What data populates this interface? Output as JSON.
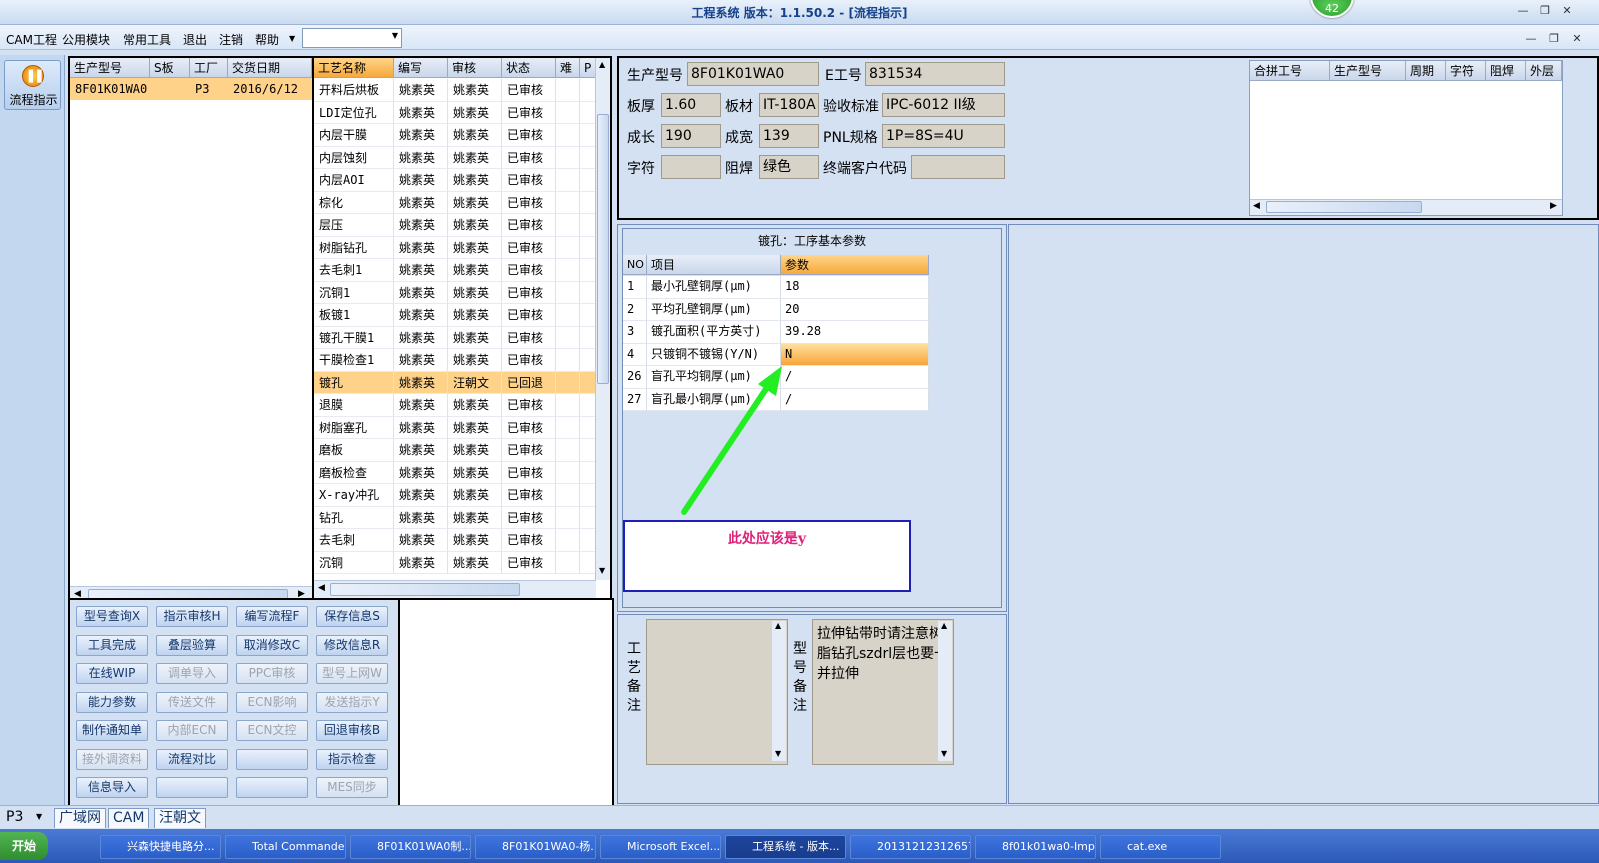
{
  "window": {
    "title": "工程系统  版本：1.1.50.2 - [流程指示]",
    "badge": "42"
  },
  "menu": [
    "CAM工程",
    "公用模块",
    "常用工具",
    "退出",
    "注销",
    "帮助"
  ],
  "left": {
    "flow_button": "流程指示"
  },
  "orders": {
    "headers": [
      "生产型号",
      "S板",
      "工厂",
      "交货日期"
    ],
    "rows": [
      [
        "8F01K01WA0",
        "",
        "P3",
        "2016/6/12"
      ]
    ]
  },
  "process": {
    "headers": [
      "工艺名称",
      "编写",
      "审核",
      "状态",
      "难",
      "P"
    ],
    "rows": [
      [
        "开料后烘板",
        "姚素英",
        "姚素英",
        "已审核"
      ],
      [
        "LDI定位孔",
        "姚素英",
        "姚素英",
        "已审核"
      ],
      [
        "内层干膜",
        "姚素英",
        "姚素英",
        "已审核"
      ],
      [
        "内层蚀刻",
        "姚素英",
        "姚素英",
        "已审核"
      ],
      [
        "内层AOI",
        "姚素英",
        "姚素英",
        "已审核"
      ],
      [
        "棕化",
        "姚素英",
        "姚素英",
        "已审核"
      ],
      [
        "层压",
        "姚素英",
        "姚素英",
        "已审核"
      ],
      [
        "树脂钻孔",
        "姚素英",
        "姚素英",
        "已审核"
      ],
      [
        "去毛刺1",
        "姚素英",
        "姚素英",
        "已审核"
      ],
      [
        "沉铜1",
        "姚素英",
        "姚素英",
        "已审核"
      ],
      [
        "板镀1",
        "姚素英",
        "姚素英",
        "已审核"
      ],
      [
        "镀孔干膜1",
        "姚素英",
        "姚素英",
        "已审核"
      ],
      [
        "干膜检查1",
        "姚素英",
        "姚素英",
        "已审核"
      ],
      [
        "镀孔",
        "姚素英",
        "汪朝文",
        "已回退"
      ],
      [
        "退膜",
        "姚素英",
        "姚素英",
        "已审核"
      ],
      [
        "树脂塞孔",
        "姚素英",
        "姚素英",
        "已审核"
      ],
      [
        "磨板",
        "姚素英",
        "姚素英",
        "已审核"
      ],
      [
        "磨板检查",
        "姚素英",
        "姚素英",
        "已审核"
      ],
      [
        "X-ray冲孔",
        "姚素英",
        "姚素英",
        "已审核"
      ],
      [
        "钻孔",
        "姚素英",
        "姚素英",
        "已审核"
      ],
      [
        "去毛刺",
        "姚素英",
        "姚素英",
        "已审核"
      ],
      [
        "沉铜",
        "姚素英",
        "姚素英",
        "已审核"
      ]
    ],
    "selected_index": 13
  },
  "buttons": [
    [
      {
        "label": "型号查询X",
        "enabled": true
      },
      {
        "label": "指示审核H",
        "enabled": true
      },
      {
        "label": "编写流程F",
        "enabled": true
      },
      {
        "label": "保存信息S",
        "enabled": true
      }
    ],
    [
      {
        "label": "工具完成",
        "enabled": true
      },
      {
        "label": "叠层验算",
        "enabled": true
      },
      {
        "label": "取消修改C",
        "enabled": true
      },
      {
        "label": "修改信息R",
        "enabled": true
      }
    ],
    [
      {
        "label": "在线WIP",
        "enabled": true
      },
      {
        "label": "调单导入",
        "enabled": false
      },
      {
        "label": "PPC审核",
        "enabled": false
      },
      {
        "label": "型号上网W",
        "enabled": false
      }
    ],
    [
      {
        "label": "能力参数",
        "enabled": true
      },
      {
        "label": "传送文件",
        "enabled": false
      },
      {
        "label": "ECN影响",
        "enabled": false
      },
      {
        "label": "发送指示Y",
        "enabled": false
      }
    ],
    [
      {
        "label": "制作通知单",
        "enabled": true
      },
      {
        "label": "内部ECN",
        "enabled": false
      },
      {
        "label": "ECN文控",
        "enabled": false
      },
      {
        "label": "回退审核B",
        "enabled": true
      }
    ],
    [
      {
        "label": "接外调资料",
        "enabled": false
      },
      {
        "label": "流程对比",
        "enabled": true
      },
      {
        "label": "",
        "enabled": true
      },
      {
        "label": "指示检查",
        "enabled": true
      }
    ],
    [
      {
        "label": "信息导入",
        "enabled": true
      },
      {
        "label": "",
        "enabled": true
      },
      {
        "label": "",
        "enabled": true
      },
      {
        "label": "MES同步",
        "enabled": false
      }
    ]
  ],
  "info": {
    "prod_model_label": "生产型号",
    "prod_model": "8F01K01WA0",
    "e_no_label": "E工号",
    "e_no": "831534",
    "thickness_label": "板厚",
    "thickness": "1.60",
    "material_label": "板材",
    "material": "IT-180A",
    "standard_label": "验收标准",
    "standard": "IPC-6012 II级",
    "grow_label": "成长",
    "grow": "190",
    "width_label": "成宽",
    "width": "139",
    "pnl_label": "PNL规格",
    "pnl": "1P=8S=4U",
    "char_label": "字符",
    "char": "",
    "mask_label": "阻焊",
    "mask": "绿色",
    "customer_label": "终端客户代码",
    "customer": ""
  },
  "merge_table": {
    "headers": [
      "合拼工号",
      "生产型号",
      "周期",
      "字符",
      "阻焊",
      "外层"
    ]
  },
  "params": {
    "title": "镀孔：工序基本参数",
    "headers": [
      "NO",
      "项目",
      "参数"
    ],
    "rows": [
      [
        "1",
        "最小孔壁铜厚(μm)",
        "18"
      ],
      [
        "2",
        "平均孔壁铜厚(μm)",
        "20"
      ],
      [
        "3",
        "镀孔面积(平方英寸)",
        "39.28"
      ],
      [
        "4",
        "只镀铜不镀锡(Y/N)",
        "N"
      ],
      [
        "26",
        "盲孔平均铜厚(μm)",
        "/"
      ],
      [
        "27",
        "盲孔最小铜厚(μm)",
        "/"
      ]
    ],
    "selected_index": 3
  },
  "annotation": {
    "text": "此处应该是y",
    "arrow_color": "#22ee22",
    "box_color": "#1f1fb8",
    "text_color": "#e0207a"
  },
  "remarks": {
    "process_label": "工艺备注",
    "process_text": "",
    "model_label": "型号备注",
    "model_text": "拉伸钻带时请注意树脂钻孔szdrl层也要一并拉伸"
  },
  "status_tabs": {
    "site": "P3",
    "tabs": [
      "广域网",
      "CAM",
      "汪朝文"
    ]
  },
  "taskbar": [
    "开始",
    "兴森快捷电路分...",
    "Total Commander",
    "8F01K01WA0制...",
    "8F01K01WA0-杨...",
    "Microsoft Excel...",
    "工程系统 - 版本...",
    "20131212312657...",
    "8f01k01wa0-Imp...",
    "cat.exe"
  ]
}
